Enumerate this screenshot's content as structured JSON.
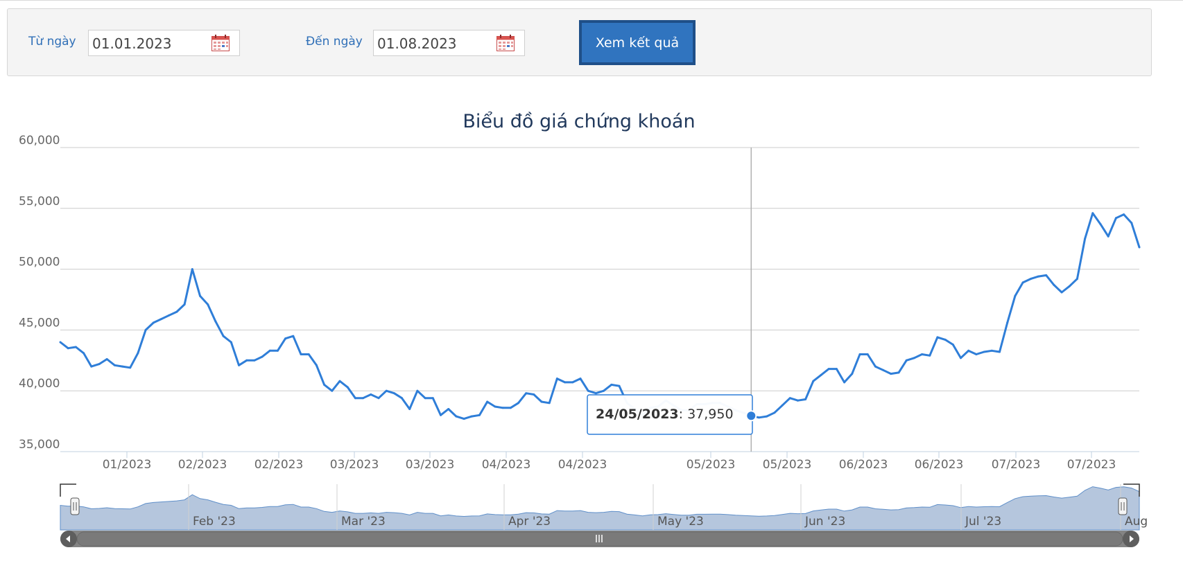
{
  "filter": {
    "from_label": "Từ ngày",
    "from_value": "01.01.2023",
    "to_label": "Đến ngày",
    "to_value": "01.08.2023",
    "submit_label": "Xem kết quả",
    "calendar_icon": "calendar-icon"
  },
  "colors": {
    "accent": "#3074bf",
    "line": "#2f7ed8",
    "navigator_fill": "#b5c6dd",
    "button_dark": "#1f4f88"
  },
  "chart_data": {
    "type": "line",
    "title": "Biểu đồ giá chứng khoán",
    "ylim": [
      35000,
      60000
    ],
    "y_ticks": [
      35000,
      40000,
      45000,
      50000,
      55000,
      60000
    ],
    "y_tick_labels": [
      "35,000",
      "40,000",
      "45,000",
      "50,000",
      "55,000",
      "60,000"
    ],
    "x_tick_labels": [
      "01/2023",
      "02/2023",
      "02/2023",
      "03/2023",
      "03/2023",
      "04/2023",
      "04/2023",
      "05/2023",
      "05/2023",
      "06/2023",
      "06/2023",
      "07/2023",
      "07/2023"
    ],
    "grid": true,
    "series": [
      {
        "values": [
          44000,
          43500,
          43600,
          43100,
          42000,
          42200,
          42600,
          42100,
          42000,
          41900,
          43100,
          45000,
          45600,
          45900,
          46200,
          46500,
          47100,
          50000,
          47800,
          47100,
          45700,
          44500,
          44000,
          42100,
          42500,
          42500,
          42800,
          43300,
          43300,
          44300,
          44500,
          43000,
          43000,
          42100,
          40500,
          40000,
          40800,
          40300,
          39400,
          39400,
          39700,
          39400,
          40000,
          39800,
          39400,
          38500,
          40000,
          39400,
          39400,
          38000,
          38500,
          37900,
          37700,
          37900,
          38000,
          39100,
          38700,
          38600,
          38600,
          39000,
          39800,
          39700,
          39100,
          39000,
          41000,
          40700,
          40700,
          41000,
          40000,
          39800,
          40000,
          40500,
          40400,
          39000,
          38500,
          38000,
          38600,
          38700,
          39200,
          38800,
          38400,
          38400,
          38900,
          38900,
          39000,
          39000,
          38700,
          38400,
          38200,
          37950,
          37800,
          37900,
          38200,
          38800,
          39400,
          39200,
          39300,
          40800,
          41300,
          41800,
          41800,
          40700,
          41400,
          43000,
          43000,
          42000,
          41700,
          41400,
          41500,
          42500,
          42700,
          43000,
          42900,
          44400,
          44200,
          43800,
          42700,
          43300,
          43000,
          43200,
          43300,
          43200,
          45600,
          47800,
          48900,
          49200,
          49400,
          49500,
          48700,
          48100,
          48600,
          49200,
          52500,
          54600,
          53700,
          52700,
          54200,
          54500,
          53800,
          51800
        ]
      }
    ],
    "tooltip": {
      "date": "24/05/2023",
      "value": "37,950"
    },
    "navigator": {
      "labels": [
        "Feb '23",
        "Mar '23",
        "Apr '23",
        "May '23",
        "Jun '23",
        "Jul '23",
        "Aug"
      ],
      "handle_icon": "grip-icon",
      "left_arrow_icon": "arrow-left-icon",
      "right_arrow_icon": "arrow-right-icon"
    }
  }
}
